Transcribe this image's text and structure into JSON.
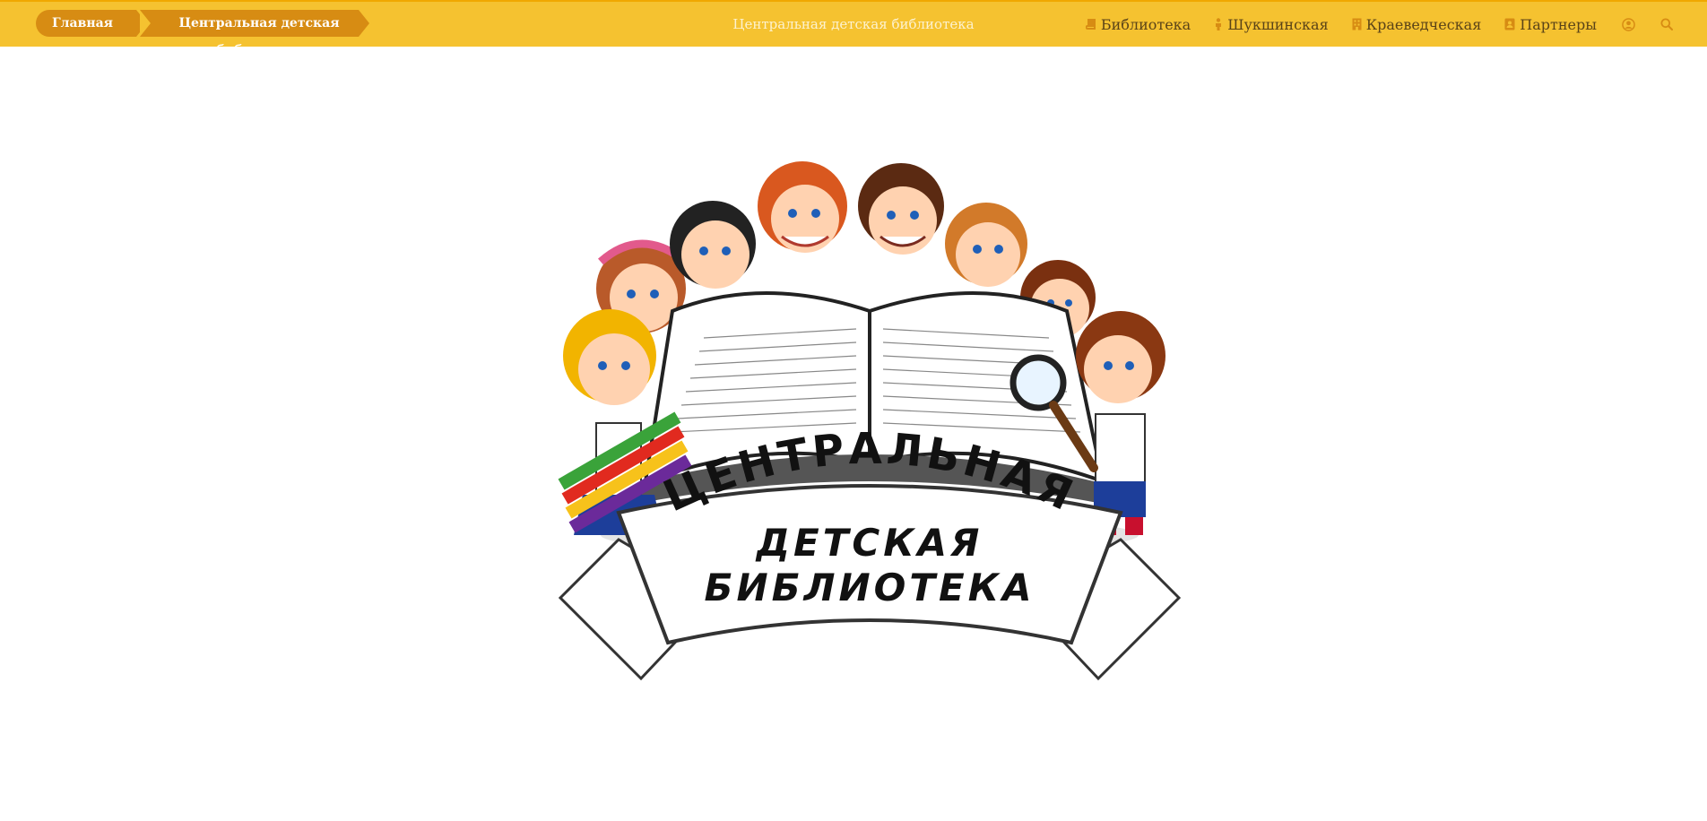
{
  "breadcrumb": {
    "home_label": "Главная",
    "current_label": "Центральная детская библиотека"
  },
  "header": {
    "site_title": "Центральная детская библиотека"
  },
  "nav": {
    "items": [
      {
        "label": "Библиотека",
        "icon": "book-icon"
      },
      {
        "label": "Шукшинская",
        "icon": "person-icon"
      },
      {
        "label": "Краеведческая",
        "icon": "building-icon"
      },
      {
        "label": "Партнеры",
        "icon": "contact-card-icon"
      }
    ],
    "account_icon": "user-circle-icon",
    "search_icon": "search-icon"
  },
  "logo": {
    "line1": "ЦЕНТРАЛЬНАЯ",
    "line2": "ДЕТСКАЯ",
    "line3": "БИБЛИОТЕКА"
  },
  "colors": {
    "header_bg": "#f5c230",
    "crumb_bg": "#d78c13",
    "nav_text": "#5a4318",
    "nav_icon": "#d78c13"
  }
}
